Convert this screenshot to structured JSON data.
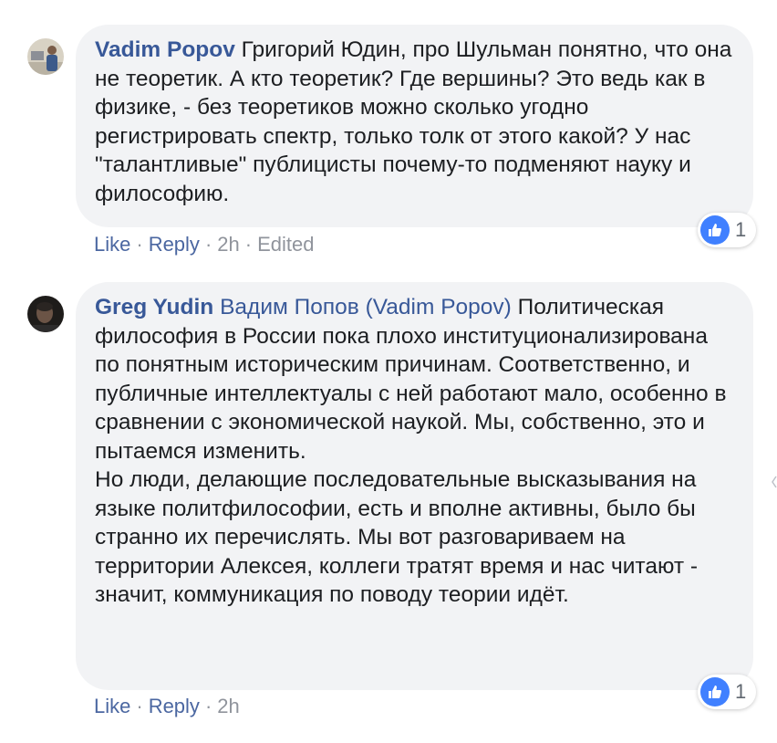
{
  "comments": [
    {
      "author": "Vadim Popov",
      "mention": "",
      "paragraphs": [
        "Григорий Юдин, про Шульман понятно, что она не теоретик. А кто теоретик? Где вершины? Это ведь как в физике, - без теоретиков можно сколько угодно регистрировать спектр, только толк от этого какой? У нас \"талантливые\" публицисты почему-то подменяют науку и философию."
      ],
      "actions": {
        "like": "Like",
        "reply": "Reply",
        "time": "2h",
        "edited": "Edited"
      },
      "reaction_count": "1"
    },
    {
      "author": "Greg Yudin",
      "mention": "Вадим Попов (Vadim Popov)",
      "paragraphs": [
        "Политическая философия в России пока плохо институционализирована по понятным историческим причинам. Соответственно, и публичные интеллектуалы с ней работают мало, особенно в сравнении с экономической наукой. Мы, собственно, это и пытаемся изменить.",
        "Но люди, делающие последовательные высказывания на языке политфилософии, есть и вполне активны, было бы странно их перечислять. Мы вот разговариваем на территории Алексея, коллеги тратят время и нас читают - значит, коммуникация по поводу теории идёт."
      ],
      "actions": {
        "like": "Like",
        "reply": "Reply",
        "time": "2h"
      },
      "reaction_count": "1"
    }
  ],
  "separator": "·",
  "icons": {
    "reaction": "thumbs-up-icon"
  },
  "colors": {
    "author": "#385898",
    "link": "#4b67a1",
    "bubble": "#f2f3f5",
    "like_badge": "#4080ff",
    "meta": "#90949c"
  }
}
